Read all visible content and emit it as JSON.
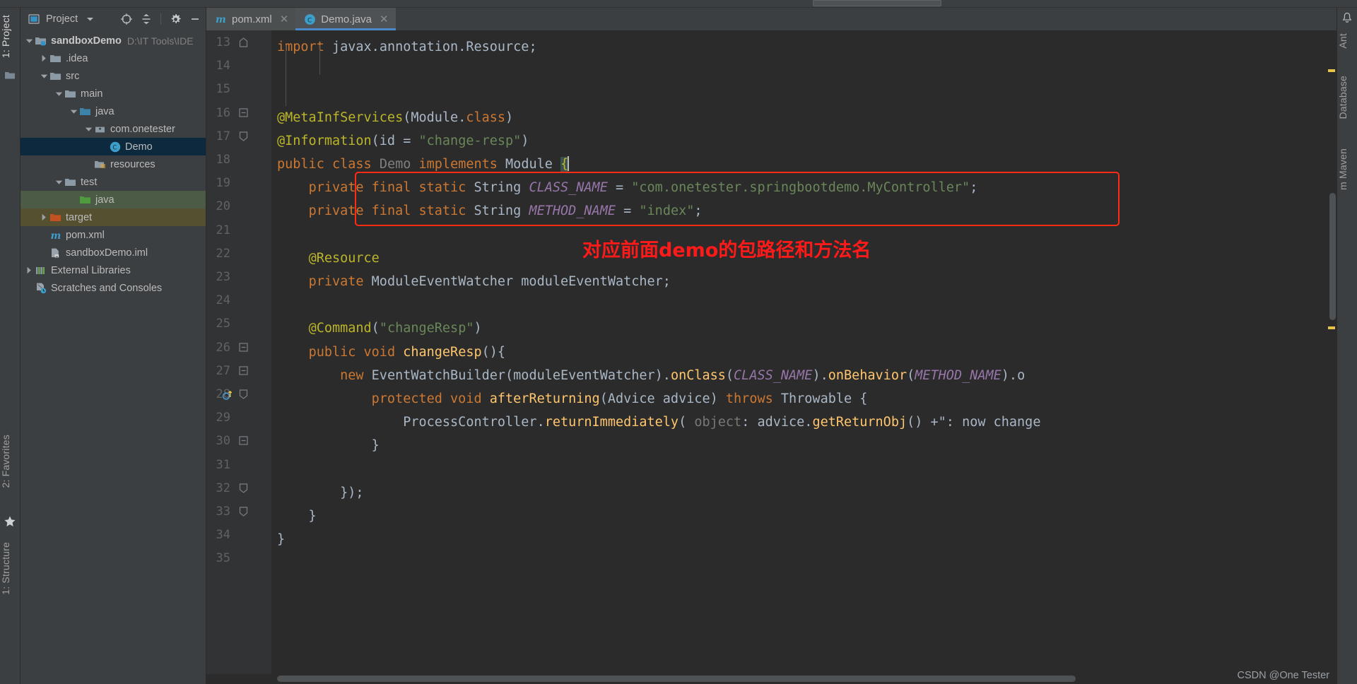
{
  "window": {
    "theme_bg": "#3c3f41",
    "editor_bg": "#2b2b2b",
    "accent": "#4a88c7",
    "annotation_color": "#ff1a1a"
  },
  "left_tool_bar": {
    "tabs": [
      {
        "id": "project",
        "label": "1: Project",
        "selected": true
      },
      {
        "id": "favorites",
        "label": "2: Favorites",
        "selected": false
      },
      {
        "id": "structure",
        "label": "1: Structure",
        "selected": false
      }
    ],
    "icons": [
      {
        "name": "project-window-icon"
      },
      {
        "name": "star-icon"
      }
    ]
  },
  "right_tool_bar": {
    "tabs": [
      {
        "id": "ant",
        "label": "Ant",
        "selected": false
      },
      {
        "id": "database",
        "label": "Database",
        "selected": false
      },
      {
        "id": "maven",
        "label": "m Maven",
        "selected": false
      }
    ],
    "icons": [
      {
        "name": "notifications-bell-icon"
      }
    ]
  },
  "project_panel": {
    "title": "Project",
    "dropdown_icon": "chevron-down-icon",
    "toolbar_buttons": [
      {
        "name": "locate-target-icon",
        "tooltip": "Select Opened File"
      },
      {
        "name": "collapse-all-icon",
        "tooltip": "Collapse All"
      },
      {
        "name": "gear-icon",
        "tooltip": "Settings"
      },
      {
        "name": "minimize-icon",
        "tooltip": "Hide"
      }
    ],
    "tree": [
      {
        "label": "sandboxDemo",
        "secondary": "D:\\IT Tools\\IDE",
        "depth": 0,
        "arrow": "down",
        "icon": "module-folder-icon",
        "bold": true,
        "state": "none"
      },
      {
        "label": ".idea",
        "secondary": "",
        "depth": 1,
        "arrow": "right",
        "icon": "folder-icon",
        "bold": false,
        "state": "none"
      },
      {
        "label": "src",
        "secondary": "",
        "depth": 1,
        "arrow": "down",
        "icon": "folder-icon",
        "bold": false,
        "state": "none"
      },
      {
        "label": "main",
        "secondary": "",
        "depth": 2,
        "arrow": "down",
        "icon": "folder-icon",
        "bold": false,
        "state": "none"
      },
      {
        "label": "java",
        "secondary": "",
        "depth": 3,
        "arrow": "down",
        "icon": "source-root-folder-icon",
        "bold": false,
        "state": "none"
      },
      {
        "label": "com.onetester",
        "secondary": "",
        "depth": 4,
        "arrow": "down",
        "icon": "package-icon",
        "bold": false,
        "state": "none"
      },
      {
        "label": "Demo",
        "secondary": "",
        "depth": 5,
        "arrow": "none",
        "icon": "java-class-icon",
        "bold": false,
        "state": "selected"
      },
      {
        "label": "resources",
        "secondary": "",
        "depth": 4,
        "arrow": "none",
        "icon": "resources-folder-icon",
        "bold": false,
        "state": "none"
      },
      {
        "label": "test",
        "secondary": "",
        "depth": 2,
        "arrow": "down",
        "icon": "folder-icon",
        "bold": false,
        "state": "none"
      },
      {
        "label": "java",
        "secondary": "",
        "depth": 3,
        "arrow": "none",
        "icon": "test-source-folder-icon",
        "bold": false,
        "state": "green"
      },
      {
        "label": "target",
        "secondary": "",
        "depth": 1,
        "arrow": "right",
        "icon": "excluded-folder-icon",
        "bold": false,
        "state": "brown"
      },
      {
        "label": "pom.xml",
        "secondary": "",
        "depth": 1,
        "arrow": "none",
        "icon": "maven-file-icon",
        "bold": false,
        "state": "none"
      },
      {
        "label": "sandboxDemo.iml",
        "secondary": "",
        "depth": 1,
        "arrow": "none",
        "icon": "iml-file-icon",
        "bold": false,
        "state": "none"
      },
      {
        "label": "External Libraries",
        "secondary": "",
        "depth": 0,
        "arrow": "right",
        "icon": "libraries-icon",
        "bold": false,
        "state": "none"
      },
      {
        "label": "Scratches and Consoles",
        "secondary": "",
        "depth": 0,
        "arrow": "none",
        "icon": "scratches-icon",
        "bold": false,
        "state": "none"
      }
    ]
  },
  "editor": {
    "tabs": [
      {
        "label": "pom.xml",
        "icon": "maven-file-icon",
        "active": false,
        "close_icon": "close-icon"
      },
      {
        "label": "Demo.java",
        "icon": "java-class-icon",
        "active": true,
        "close_icon": "close-icon"
      }
    ],
    "first_line_number": 13,
    "line_numbers": [
      13,
      14,
      15,
      16,
      17,
      18,
      19,
      20,
      21,
      22,
      23,
      24,
      25,
      26,
      27,
      28,
      29,
      30,
      31,
      32,
      33,
      34,
      35
    ],
    "lines": [
      {
        "n": 13,
        "text": "import javax.annotation.Resource;"
      },
      {
        "n": 14,
        "text": ""
      },
      {
        "n": 15,
        "text": ""
      },
      {
        "n": 16,
        "text": "@MetaInfServices(Module.class)"
      },
      {
        "n": 17,
        "text": "@Information(id = \"change-resp\")"
      },
      {
        "n": 18,
        "text": "public class Demo implements Module {"
      },
      {
        "n": 19,
        "text": "    private final static String CLASS_NAME = \"com.onetester.springbootdemo.MyController\";"
      },
      {
        "n": 20,
        "text": "    private final static String METHOD_NAME = \"index\";"
      },
      {
        "n": 21,
        "text": ""
      },
      {
        "n": 22,
        "text": "    @Resource"
      },
      {
        "n": 23,
        "text": "    private ModuleEventWatcher moduleEventWatcher;"
      },
      {
        "n": 24,
        "text": ""
      },
      {
        "n": 25,
        "text": "    @Command(\"changeResp\")"
      },
      {
        "n": 26,
        "text": "    public void changeResp(){"
      },
      {
        "n": 27,
        "text": "        new EventWatchBuilder(moduleEventWatcher).onClass(CLASS_NAME).onBehavior(METHOD_NAME).o"
      },
      {
        "n": 28,
        "text": "            protected void afterReturning(Advice advice) throws Throwable {"
      },
      {
        "n": 29,
        "text": "                ProcessController.returnImmediately( object: advice.getReturnObj() +\": now change"
      },
      {
        "n": 30,
        "text": "            }"
      },
      {
        "n": 31,
        "text": ""
      },
      {
        "n": 32,
        "text": "        });"
      },
      {
        "n": 33,
        "text": "    }"
      },
      {
        "n": 34,
        "text": "}"
      },
      {
        "n": 35,
        "text": ""
      }
    ],
    "inlay_hint": "object:",
    "caret_line": 18,
    "gutter_icons": [
      {
        "line": 28,
        "name": "override-method-icon"
      }
    ],
    "fold_markers": [
      {
        "line": 13,
        "type": "fold-start-icon"
      },
      {
        "line": 16,
        "type": "fold-collapse-icon"
      },
      {
        "line": 17,
        "type": "fold-end-icon"
      },
      {
        "line": 26,
        "type": "fold-collapse-icon"
      },
      {
        "line": 27,
        "type": "fold-collapse-icon"
      },
      {
        "line": 28,
        "type": "fold-end-icon"
      },
      {
        "line": 30,
        "type": "fold-collapse-icon"
      },
      {
        "line": 32,
        "type": "fold-end-icon"
      },
      {
        "line": 33,
        "type": "fold-end-icon"
      }
    ]
  },
  "annotations": {
    "red_box_lines": [
      19,
      20
    ],
    "red_text": "对应前面demo的包路径和方法名"
  },
  "markers": [
    {
      "color": "#e8c34a",
      "position_pct": 6
    },
    {
      "color": "#e8c34a",
      "position_pct": 46
    }
  ],
  "watermark": "CSDN @One Tester"
}
